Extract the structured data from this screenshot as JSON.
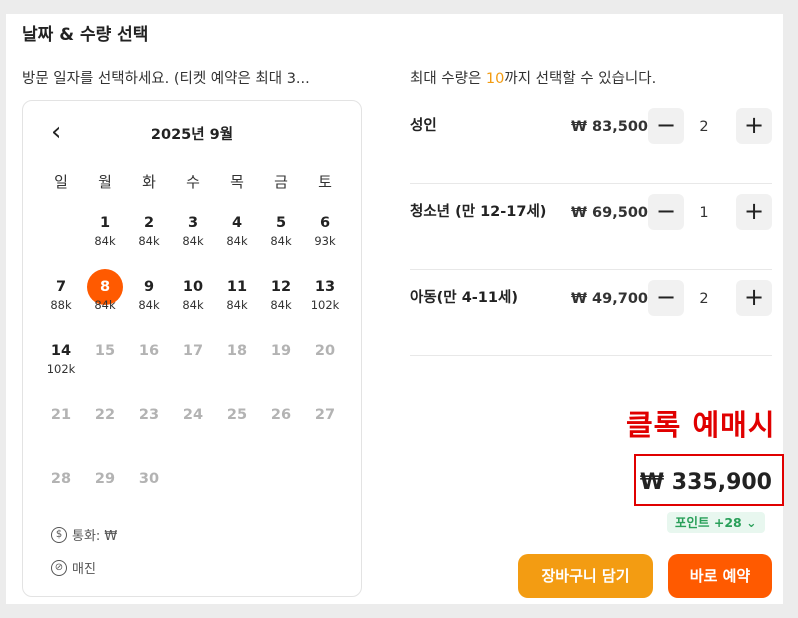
{
  "title": "날짜 & 수량 선택",
  "date_hint": "방문 일자를 선택하세요. (티켓 예약은 최대 3...",
  "calendar": {
    "month_label": "2025년 9월",
    "prev_icon": "chevron-left-icon",
    "weekdays": [
      "일",
      "월",
      "화",
      "수",
      "목",
      "금",
      "토"
    ],
    "days": [
      {
        "n": "1",
        "p": "84k"
      },
      {
        "n": "2",
        "p": "84k"
      },
      {
        "n": "3",
        "p": "84k"
      },
      {
        "n": "4",
        "p": "84k"
      },
      {
        "n": "5",
        "p": "84k"
      },
      {
        "n": "6",
        "p": "93k"
      },
      {
        "n": "7",
        "p": "88k"
      },
      {
        "n": "8",
        "p": "84k"
      },
      {
        "n": "9",
        "p": "84k"
      },
      {
        "n": "10",
        "p": "84k"
      },
      {
        "n": "11",
        "p": "84k"
      },
      {
        "n": "12",
        "p": "84k"
      },
      {
        "n": "13",
        "p": "102k"
      },
      {
        "n": "14",
        "p": "102k"
      },
      {
        "n": "15",
        "p": ""
      },
      {
        "n": "16",
        "p": ""
      },
      {
        "n": "17",
        "p": ""
      },
      {
        "n": "18",
        "p": ""
      },
      {
        "n": "19",
        "p": ""
      },
      {
        "n": "20",
        "p": ""
      },
      {
        "n": "21",
        "p": ""
      },
      {
        "n": "22",
        "p": ""
      },
      {
        "n": "23",
        "p": ""
      },
      {
        "n": "24",
        "p": ""
      },
      {
        "n": "25",
        "p": ""
      },
      {
        "n": "26",
        "p": ""
      },
      {
        "n": "27",
        "p": ""
      },
      {
        "n": "28",
        "p": ""
      },
      {
        "n": "29",
        "p": ""
      },
      {
        "n": "30",
        "p": ""
      }
    ],
    "selected_day": "8",
    "legend": {
      "currency": "통화: ₩",
      "soldout": "매진"
    }
  },
  "quantity_hint": {
    "prefix": "최대 수량은 ",
    "max": "10",
    "suffix": "까지 선택할 수 있습니다."
  },
  "tickets": [
    {
      "label": "성인",
      "price": "₩ 83,500",
      "qty": "2"
    },
    {
      "label": "청소년 (만 12-17세)",
      "price": "₩ 69,500",
      "qty": "1"
    },
    {
      "label": "아동(만 4-11세)",
      "price": "₩ 49,700",
      "qty": "2"
    }
  ],
  "annotation": "클록 예매시",
  "total": "₩ 335,900",
  "points": "포인트 +28",
  "buttons": {
    "cart": "장바구니 담기",
    "book": "바로 예약"
  },
  "colors": {
    "accent": "#ff5a00",
    "cart": "#f39c12",
    "annotation": "#e00000",
    "points": "#2aa05a"
  }
}
